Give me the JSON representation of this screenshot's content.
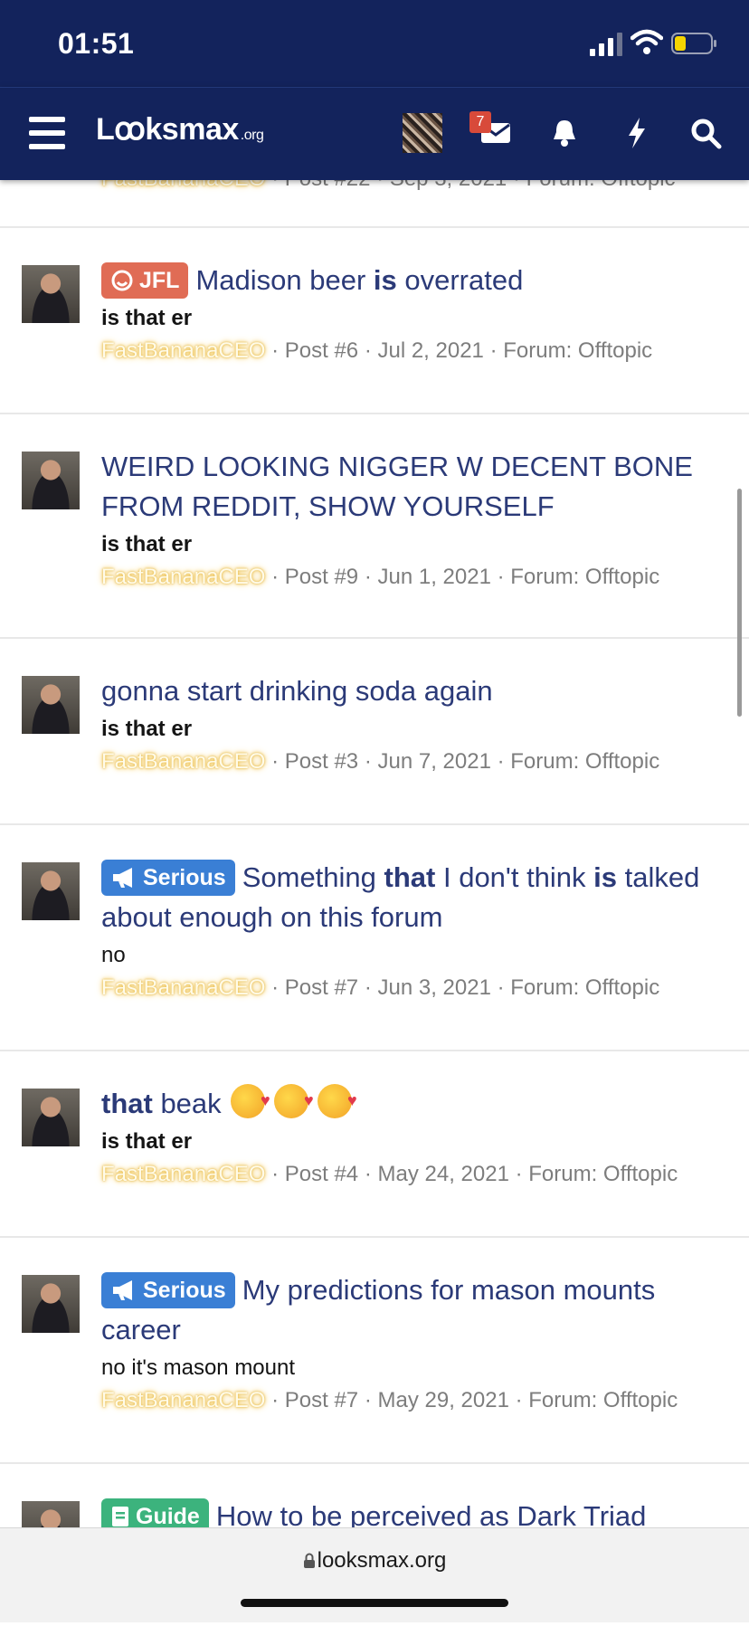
{
  "status": {
    "time": "01:51"
  },
  "nav": {
    "logo_main": "Lꝏksmax",
    "logo_suffix": ".org",
    "notification_count": "7"
  },
  "partial_meta": {
    "author": "FastBananaCEO",
    "post": "Post #22",
    "date": "Sep 3, 2021",
    "forum": "Forum: Offtopic"
  },
  "results": [
    {
      "prefix": "JFL",
      "title_segments": [
        "Madison beer ",
        "is",
        " overrated"
      ],
      "snippet": "is that er",
      "author": "FastBananaCEO",
      "post": "Post #6",
      "date": "Jul 2, 2021",
      "forum": "Forum: Offtopic"
    },
    {
      "title": "WEIRD LOOKING NIGGER W DECENT BONE FROM REDDIT, SHOW YOURSELF",
      "snippet": "is that er",
      "author": "FastBananaCEO",
      "post": "Post #9",
      "date": "Jun 1, 2021",
      "forum": "Forum: Offtopic"
    },
    {
      "title": "gonna start drinking soda again",
      "snippet": "is that er",
      "author": "FastBananaCEO",
      "post": "Post #3",
      "date": "Jun 7, 2021",
      "forum": "Forum: Offtopic"
    },
    {
      "prefix": "Serious",
      "title_segments": [
        "Something ",
        "that",
        " I don't think ",
        "is",
        " talked about enough on this forum"
      ],
      "snippet": "no",
      "author": "FastBananaCEO",
      "post": "Post #7",
      "date": "Jun 3, 2021",
      "forum": "Forum: Offtopic"
    },
    {
      "title_segments": [
        "that",
        " beak"
      ],
      "emoji": "smiling-face-with-hearts",
      "snippet": "is that er",
      "author": "FastBananaCEO",
      "post": "Post #4",
      "date": "May 24, 2021",
      "forum": "Forum: Offtopic"
    },
    {
      "prefix": "Serious",
      "title": "My predictions for mason mounts career",
      "snippet": "no it's mason mount",
      "author": "FastBananaCEO",
      "post": "Post #7",
      "date": "May 29, 2021",
      "forum": "Forum: Offtopic"
    },
    {
      "prefix": "Guide",
      "title": "How to be perceived as Dark Triad"
    }
  ],
  "browser": {
    "url": "looksmax.org"
  }
}
